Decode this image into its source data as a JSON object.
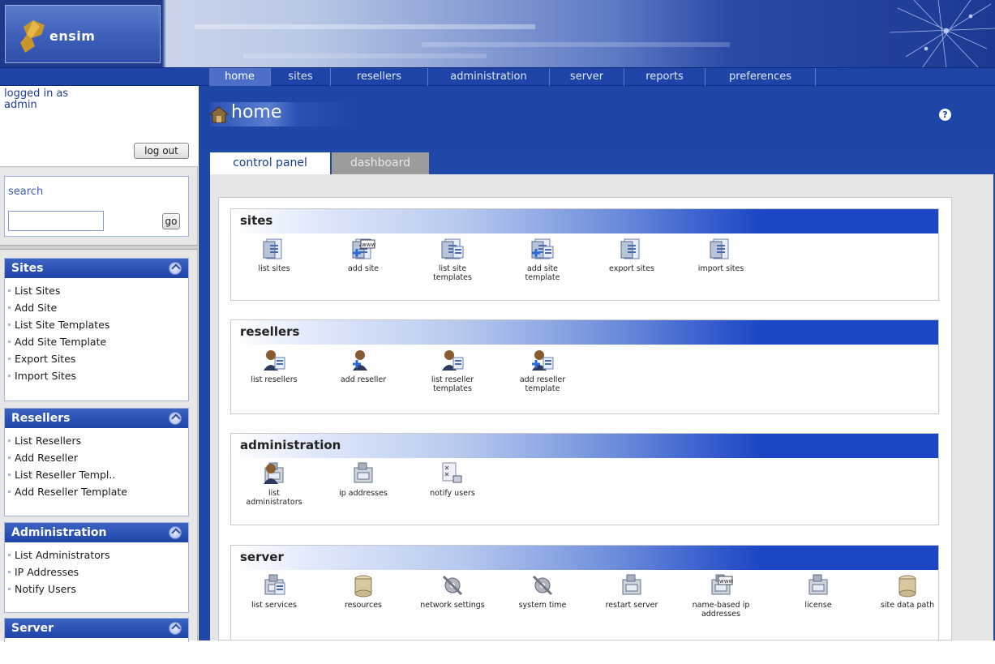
{
  "brand": {
    "logo_text": "ensim"
  },
  "top_nav": [
    "home",
    "sites",
    "resellers",
    "administration",
    "server",
    "reports",
    "preferences"
  ],
  "login": {
    "label": "logged in as",
    "user": "admin",
    "logout": "log out"
  },
  "search": {
    "label": "search",
    "value": "",
    "go": "go"
  },
  "sidebar": {
    "sites": {
      "title": "Sites",
      "items": [
        "List Sites",
        "Add Site",
        "List Site Templates",
        "Add Site Template",
        "Export Sites",
        "Import Sites"
      ]
    },
    "resellers": {
      "title": "Resellers",
      "items": [
        "List Resellers",
        "Add Reseller",
        "List Reseller Templ..",
        "Add Reseller Template"
      ]
    },
    "administration": {
      "title": "Administration",
      "items": [
        "List Administrators",
        "IP Addresses",
        "Notify Users"
      ]
    },
    "server": {
      "title": "Server"
    }
  },
  "page": {
    "title": "home",
    "help": "?"
  },
  "tabs": {
    "control_panel": "control panel",
    "dashboard": "dashboard"
  },
  "sections": {
    "sites": {
      "title": "sites",
      "items": [
        {
          "l1": "list sites",
          "l2": "",
          "icon": "list-sites-icon"
        },
        {
          "l1": "add site",
          "l2": "",
          "icon": "add-site-icon"
        },
        {
          "l1": "list site",
          "l2": "templates",
          "icon": "list-site-templates-icon"
        },
        {
          "l1": "add site",
          "l2": "template",
          "icon": "add-site-template-icon"
        },
        {
          "l1": "export sites",
          "l2": "",
          "icon": "export-sites-icon"
        },
        {
          "l1": "import sites",
          "l2": "",
          "icon": "import-sites-icon"
        }
      ]
    },
    "resellers": {
      "title": "resellers",
      "items": [
        {
          "l1": "list resellers",
          "l2": "",
          "icon": "list-resellers-icon"
        },
        {
          "l1": "add reseller",
          "l2": "",
          "icon": "add-reseller-icon"
        },
        {
          "l1": "list reseller",
          "l2": "templates",
          "icon": "list-reseller-templates-icon"
        },
        {
          "l1": "add reseller",
          "l2": "template",
          "icon": "add-reseller-template-icon"
        }
      ]
    },
    "administration": {
      "title": "administration",
      "items": [
        {
          "l1": "list",
          "l2": "administrators",
          "icon": "list-administrators-icon"
        },
        {
          "l1": "ip addresses",
          "l2": "",
          "icon": "ip-addresses-icon"
        },
        {
          "l1": "notify users",
          "l2": "",
          "icon": "notify-users-icon"
        }
      ]
    },
    "server": {
      "title": "server",
      "items": [
        {
          "l1": "list services",
          "l2": "",
          "icon": "list-services-icon"
        },
        {
          "l1": "resources",
          "l2": "",
          "icon": "resources-icon"
        },
        {
          "l1": "network settings",
          "l2": "",
          "icon": "network-settings-icon"
        },
        {
          "l1": "system time",
          "l2": "",
          "icon": "system-time-icon"
        },
        {
          "l1": "restart server",
          "l2": "",
          "icon": "restart-server-icon"
        },
        {
          "l1": "name-based ip",
          "l2": "addresses",
          "icon": "name-based-ip-addresses-icon"
        },
        {
          "l1": "license",
          "l2": "",
          "icon": "license-icon"
        },
        {
          "l1": "site data path",
          "l2": "",
          "icon": "site-data-path-icon"
        }
      ]
    }
  }
}
